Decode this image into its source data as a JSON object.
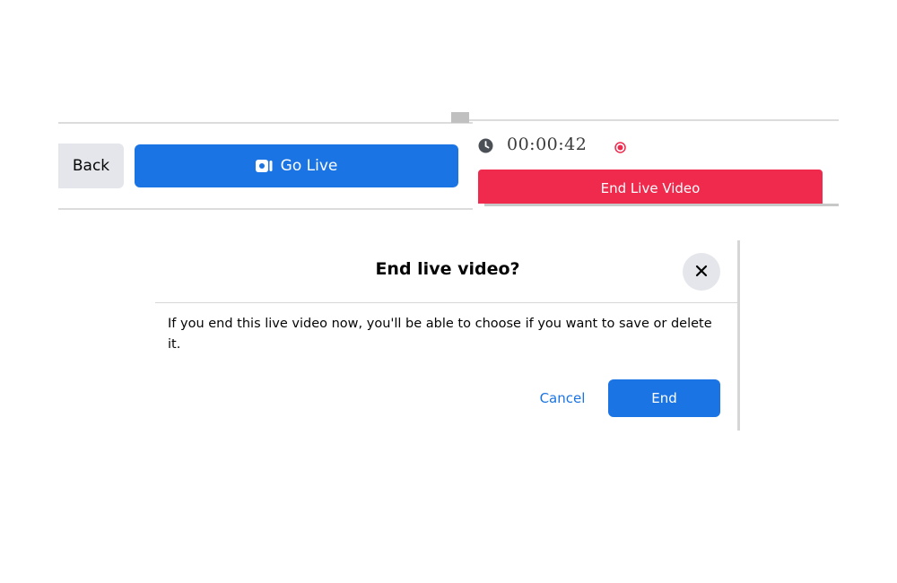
{
  "toolbar": {
    "back_label": "Back",
    "go_live_label": "Go Live",
    "go_live_icon": "video-camera-icon"
  },
  "live_panel": {
    "elapsed_time": "00:00:42",
    "clock_icon": "clock-icon",
    "recording_icon": "recording-dot-icon",
    "end_live_label": "End Live Video",
    "end_live_color": "#ef2a4d"
  },
  "dialog": {
    "title": "End live video?",
    "close_icon": "close-icon",
    "body": "If you end this live video now, you'll be able to choose if you want to save or delete it.",
    "cancel_label": "Cancel",
    "end_label": "End"
  },
  "colors": {
    "accent": "#1b74e4",
    "danger": "#ef2a4d",
    "secondary_button": "#e4e6eb"
  }
}
